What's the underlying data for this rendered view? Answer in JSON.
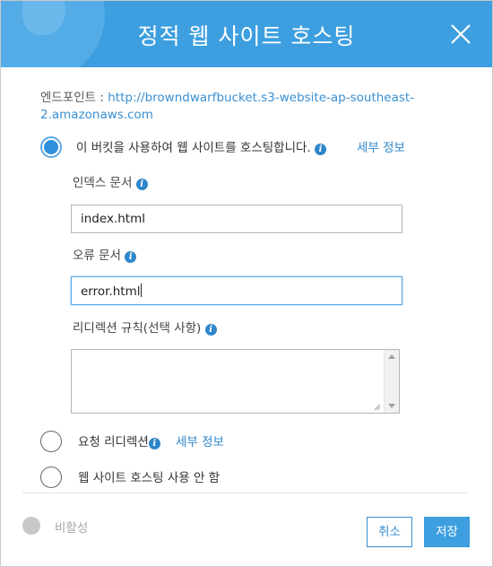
{
  "dialog": {
    "title": "정적 웹 사이트 호스팅",
    "close_icon": "close-icon"
  },
  "endpoint": {
    "label": "엔드포인트 : ",
    "url": "http://browndwarfbucket.s3-website-ap-southeast-2.amazonaws.com"
  },
  "options": [
    {
      "label": "이 버킷을 사용하여 웹 사이트를 호스팅합니다.",
      "more": "세부 정보",
      "selected": true
    },
    {
      "label": "요청 리디렉션",
      "more": "세부 정보",
      "selected": false
    },
    {
      "label": "웹 사이트 호스팅 사용 안 함",
      "selected": false
    }
  ],
  "fields": {
    "index_label": "인덱스 문서",
    "index_value": "index.html",
    "error_label": "오류 문서",
    "error_value": "error.html",
    "redirect_label": "리디렉션 규칙(선택 사항)",
    "redirect_value": ""
  },
  "footer": {
    "status": "비활성",
    "cancel_label": "취소",
    "save_label": "저장"
  },
  "colors": {
    "header": "#3d9fe0",
    "accent": "#2f86c9",
    "status_inactive": "#c8c8c8"
  }
}
